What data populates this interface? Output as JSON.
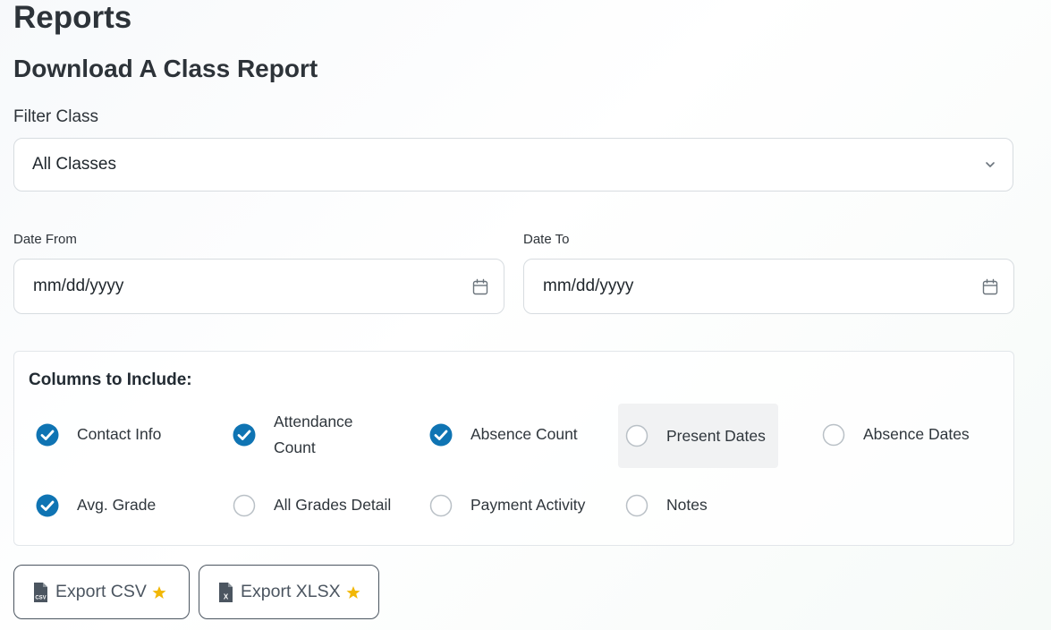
{
  "page": {
    "title": "Reports",
    "section_title": "Download A Class Report"
  },
  "filter": {
    "label": "Filter Class",
    "selected": "All Classes"
  },
  "date_from": {
    "label": "Date From",
    "placeholder": "mm/dd/yyyy"
  },
  "date_to": {
    "label": "Date To",
    "placeholder": "mm/dd/yyyy"
  },
  "columns": {
    "title": "Columns to Include:",
    "options": [
      {
        "label": "Contact Info",
        "checked": true
      },
      {
        "label": "Attendance Count",
        "checked": true
      },
      {
        "label": "Absence Count",
        "checked": true
      },
      {
        "label": "Present Dates",
        "checked": false
      },
      {
        "label": "Absence Dates",
        "checked": false
      },
      {
        "label": "Avg. Grade",
        "checked": true
      },
      {
        "label": "All Grades Detail",
        "checked": false
      },
      {
        "label": "Payment Activity",
        "checked": false
      },
      {
        "label": "Notes",
        "checked": false
      }
    ]
  },
  "buttons": {
    "export_csv": "Export CSV",
    "export_xlsx": "Export XLSX",
    "csv_badge": "CSV",
    "xlsx_badge": "X"
  },
  "colors": {
    "accent": "#0f74b3",
    "star": "#f2b705",
    "button_border": "#4b5560"
  }
}
